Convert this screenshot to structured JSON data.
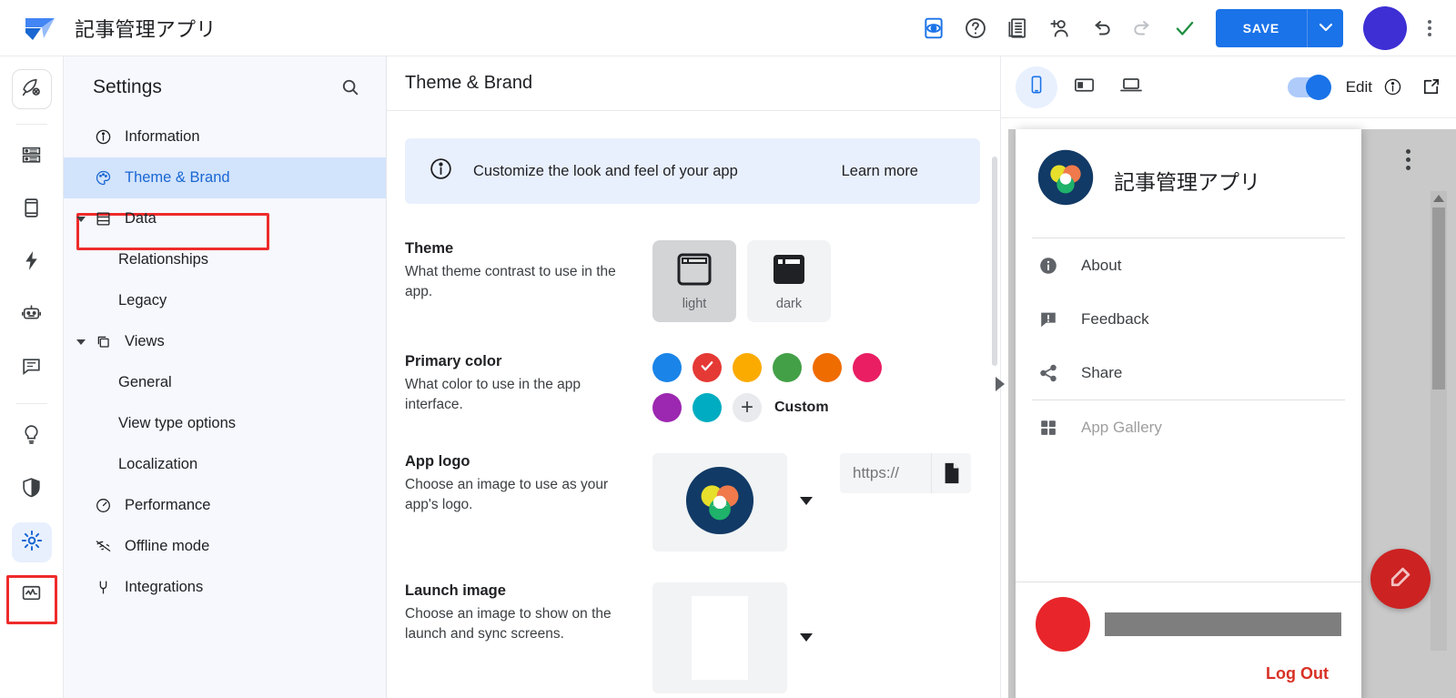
{
  "topbar": {
    "app_title": "記事管理アプリ",
    "logo_icon": "appsheet-logo-icon",
    "actions": [
      {
        "name": "preview-eye-icon",
        "label": ""
      },
      {
        "name": "help-icon",
        "label": ""
      },
      {
        "name": "spreadsheet-icon",
        "label": ""
      },
      {
        "name": "add-user-icon",
        "label": ""
      },
      {
        "name": "undo-icon",
        "label": ""
      },
      {
        "name": "redo-icon",
        "label": ""
      },
      {
        "name": "check-icon",
        "label": ""
      }
    ],
    "save_label": "SAVE"
  },
  "rail": {
    "items": [
      {
        "name": "rail-item-deploy",
        "icon": "rocket-icon"
      },
      {
        "name": "rail-item-data",
        "icon": "database-icon"
      },
      {
        "name": "rail-item-app",
        "icon": "device-icon"
      },
      {
        "name": "rail-item-automation",
        "icon": "bolt-icon"
      },
      {
        "name": "rail-item-bot",
        "icon": "robot-icon"
      },
      {
        "name": "rail-item-chat",
        "icon": "chat-icon"
      },
      {
        "name": "rail-item-intelligence",
        "icon": "lightbulb-icon"
      },
      {
        "name": "rail-item-security",
        "icon": "shield-icon"
      },
      {
        "name": "rail-item-settings",
        "icon": "gear-icon"
      },
      {
        "name": "rail-item-monitor",
        "icon": "monitor-icon"
      }
    ]
  },
  "settings": {
    "title": "Settings",
    "search_icon": "search-icon",
    "items": [
      {
        "label": "Information",
        "icon": "info-icon",
        "level": 0,
        "selected": false,
        "expandable": false
      },
      {
        "label": "Theme & Brand",
        "icon": "palette-icon",
        "level": 0,
        "selected": true,
        "expandable": false
      },
      {
        "label": "Data",
        "icon": "database-icon",
        "level": 0,
        "selected": false,
        "expandable": true
      },
      {
        "label": "Relationships",
        "icon": "",
        "level": 1,
        "selected": false,
        "expandable": false
      },
      {
        "label": "Legacy",
        "icon": "",
        "level": 1,
        "selected": false,
        "expandable": false
      },
      {
        "label": "Views",
        "icon": "layers-icon",
        "level": 0,
        "selected": false,
        "expandable": true
      },
      {
        "label": "General",
        "icon": "",
        "level": 1,
        "selected": false,
        "expandable": false
      },
      {
        "label": "View type options",
        "icon": "",
        "level": 1,
        "selected": false,
        "expandable": false
      },
      {
        "label": "Localization",
        "icon": "",
        "level": 1,
        "selected": false,
        "expandable": false
      },
      {
        "label": "Performance",
        "icon": "gauge-icon",
        "level": 0,
        "selected": false,
        "expandable": false
      },
      {
        "label": "Offline mode",
        "icon": "wifi-off-icon",
        "level": 0,
        "selected": false,
        "expandable": false
      },
      {
        "label": "Integrations",
        "icon": "plug-icon",
        "level": 0,
        "selected": false,
        "expandable": false
      }
    ]
  },
  "main": {
    "title": "Theme & Brand",
    "banner": {
      "icon": "info-icon",
      "text": "Customize the look and feel of your app",
      "link": "Learn more"
    },
    "theme": {
      "name": "Theme",
      "desc": "What theme contrast to use in the app.",
      "options": [
        {
          "label": "light",
          "selected": true
        },
        {
          "label": "dark",
          "selected": false
        }
      ]
    },
    "primary_color": {
      "name": "Primary color",
      "desc": "What color to use in the app interface.",
      "custom_label": "Custom",
      "swatches": [
        {
          "hex": "#1a84e8",
          "selected": false
        },
        {
          "hex": "#e53935",
          "selected": true
        },
        {
          "hex": "#fbab00",
          "selected": false
        },
        {
          "hex": "#43a047",
          "selected": false
        },
        {
          "hex": "#ef6c00",
          "selected": false
        },
        {
          "hex": "#e91e63",
          "selected": false
        },
        {
          "hex": "#9c27b0",
          "selected": false
        },
        {
          "hex": "#00acc1",
          "selected": false
        }
      ]
    },
    "app_logo": {
      "name": "App logo",
      "desc": "Choose an image to use as your app's logo.",
      "url_placeholder": "https://",
      "url_value": "",
      "file_icon": "file-icon"
    },
    "launch_image": {
      "name": "Launch image",
      "desc": "Choose an image to show on the launch and sync screens."
    }
  },
  "preview": {
    "devices": [
      {
        "name": "phone-preview-button",
        "icon": "phone-icon",
        "selected": true
      },
      {
        "name": "tablet-preview-button",
        "icon": "tablet-icon",
        "selected": false
      },
      {
        "name": "desktop-preview-button",
        "icon": "laptop-icon",
        "selected": false
      }
    ],
    "edit_label": "Edit",
    "edit_toggle_on": true,
    "info_icon": "info-icon",
    "open_external_icon": "external-link-icon",
    "drawer": {
      "app_title": "記事管理アプリ",
      "items": [
        {
          "label": "About",
          "icon": "info-filled-icon",
          "muted": false
        },
        {
          "label": "Feedback",
          "icon": "feedback-icon",
          "muted": false
        },
        {
          "label": "Share",
          "icon": "share-icon",
          "muted": false
        },
        {
          "label": "App Gallery",
          "icon": "grid-icon",
          "muted": true
        }
      ],
      "logout_label": "Log Out",
      "avatar_color": "#e8252a"
    },
    "fab_icon": "edit-pencil-icon",
    "fab_color": "#cc2222"
  }
}
